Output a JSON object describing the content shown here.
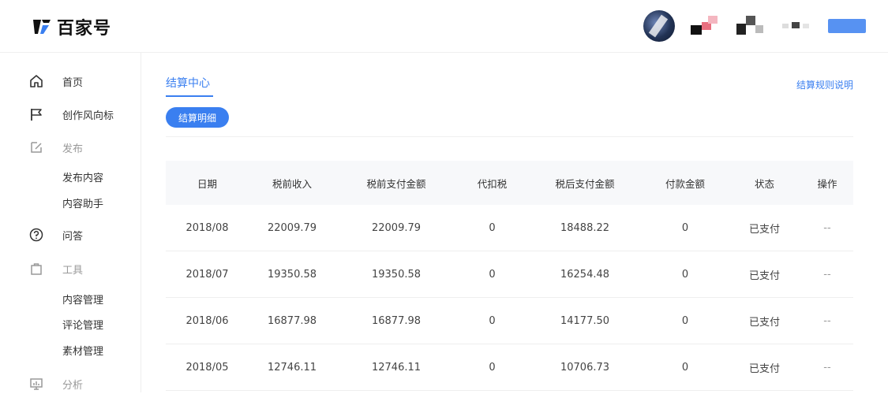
{
  "header": {
    "brand": "百家号",
    "colors": {
      "accent": "#3a7ff0"
    }
  },
  "sidebar": {
    "items": [
      {
        "label": "首页",
        "icon": "home-icon",
        "kind": "item"
      },
      {
        "label": "创作风向标",
        "icon": "flag-icon",
        "kind": "item"
      },
      {
        "label": "发布",
        "icon": "edit-icon",
        "kind": "section"
      },
      {
        "label": "发布内容",
        "kind": "sub"
      },
      {
        "label": "内容助手",
        "kind": "sub"
      },
      {
        "label": "问答",
        "icon": "question-icon",
        "kind": "item"
      },
      {
        "label": "工具",
        "icon": "bag-icon",
        "kind": "section"
      },
      {
        "label": "内容管理",
        "kind": "sub"
      },
      {
        "label": "评论管理",
        "kind": "sub"
      },
      {
        "label": "素材管理",
        "kind": "sub"
      },
      {
        "label": "分析",
        "icon": "chart-icon",
        "kind": "section"
      }
    ]
  },
  "main": {
    "tab": "结算中心",
    "rules_link": "结算规则说明",
    "detail_button": "结算明细",
    "table": {
      "headers": [
        "日期",
        "税前收入",
        "税前支付金额",
        "代扣税",
        "税后支付金额",
        "付款金额",
        "状态",
        "操作"
      ],
      "rows": [
        [
          "2018/08",
          "22009.79",
          "22009.79",
          "0",
          "18488.22",
          "0",
          "已支付",
          "--"
        ],
        [
          "2018/07",
          "19350.58",
          "19350.58",
          "0",
          "16254.48",
          "0",
          "已支付",
          "--"
        ],
        [
          "2018/06",
          "16877.98",
          "16877.98",
          "0",
          "14177.50",
          "0",
          "已支付",
          "--"
        ],
        [
          "2018/05",
          "12746.11",
          "12746.11",
          "0",
          "10706.73",
          "0",
          "已支付",
          "--"
        ]
      ]
    }
  }
}
